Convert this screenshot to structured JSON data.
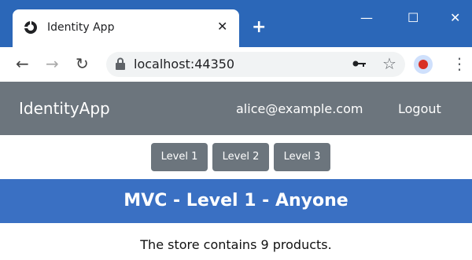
{
  "browser": {
    "tab_title": "Identity App",
    "tab_close": "✕",
    "new_tab": "+",
    "window_controls": {
      "minimize": "—",
      "maximize": "☐",
      "close": "✕"
    },
    "url": "localhost:44350",
    "icons": [
      "globe-icon",
      "lock-icon",
      "key-icon",
      "star-icon",
      "profile-icon",
      "menu-icon"
    ]
  },
  "navbar": {
    "brand": "IdentityApp",
    "user_email": "alice@example.com",
    "logout_label": "Logout"
  },
  "levels": [
    "Level 1",
    "Level 2",
    "Level 3"
  ],
  "heading": "MVC - Level 1 - Anyone",
  "content": "The store contains 9 products.",
  "colors": {
    "titlebar": "#2b67b8",
    "navbar": "#6c757d",
    "heading": "#3a70c3",
    "button": "#6c757d"
  }
}
